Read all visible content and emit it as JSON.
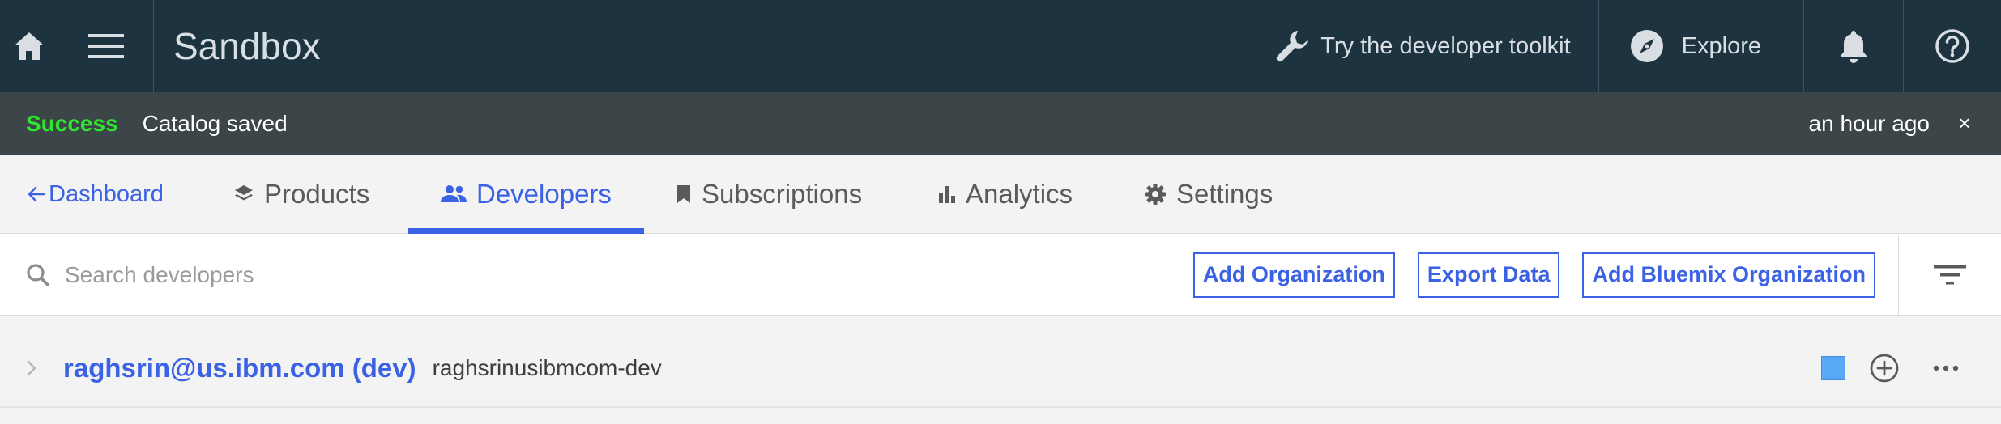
{
  "topbar": {
    "title": "Sandbox",
    "toolkit_label": "Try the developer toolkit",
    "explore_label": "Explore",
    "icons": [
      "home-icon",
      "hamburger-menu-icon",
      "wrench-icon",
      "compass-icon",
      "bell-icon",
      "help-icon"
    ]
  },
  "notification": {
    "status": "Success",
    "message": "Catalog saved",
    "timestamp": "an hour ago",
    "close": "×"
  },
  "tabs": {
    "back_label": "Dashboard",
    "items": [
      {
        "label": "Products",
        "icon": "layers-icon"
      },
      {
        "label": "Developers",
        "icon": "people-icon",
        "active": true
      },
      {
        "label": "Subscriptions",
        "icon": "bookmark-icon"
      },
      {
        "label": "Analytics",
        "icon": "bar-chart-icon"
      },
      {
        "label": "Settings",
        "icon": "gear-icon"
      }
    ]
  },
  "search": {
    "placeholder": "Search developers",
    "value": ""
  },
  "actions": {
    "add_org": "Add Organization",
    "export": "Export Data",
    "add_bluemix": "Add Bluemix Organization"
  },
  "developers": [
    {
      "title": "raghsrin@us.ibm.com (dev)",
      "subtitle": "raghsrinusibmcom-dev"
    }
  ],
  "colors": {
    "topbar": "#1d3440",
    "notice": "#3c4649",
    "success": "#2fe52f",
    "accent": "#3b62e4",
    "status_box": "#57a9f5"
  }
}
